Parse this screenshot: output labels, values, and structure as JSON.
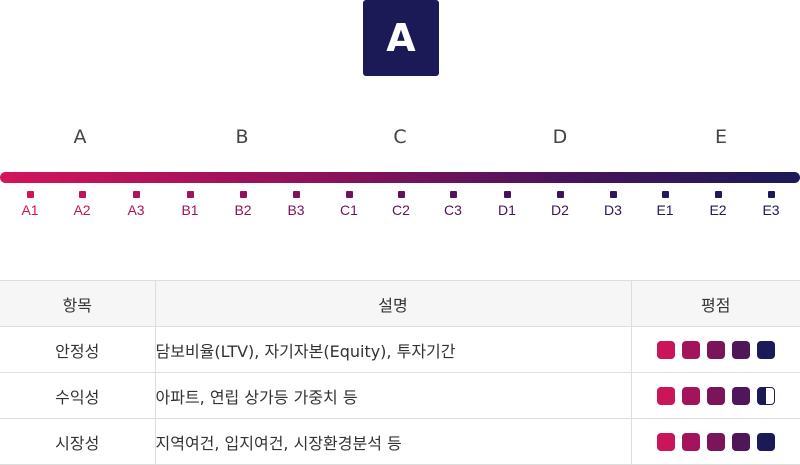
{
  "grade": {
    "badge": "A"
  },
  "scale": {
    "groups": [
      "A",
      "B",
      "C",
      "D",
      "E"
    ],
    "ticks": [
      "A1",
      "A2",
      "A3",
      "B1",
      "B2",
      "B3",
      "C1",
      "C2",
      "C3",
      "D1",
      "D2",
      "D3",
      "E1",
      "E2",
      "E3"
    ]
  },
  "colors": {
    "badge": "#1b1a57",
    "tick_colors": [
      "#cf145a",
      "#c1145a",
      "#b1135a",
      "#a1135a",
      "#91125a",
      "#81125a",
      "#71125a",
      "#61135a",
      "#53135a",
      "#45145a",
      "#3a155a",
      "#2f165a",
      "#261759",
      "#211858",
      "#1b1a57"
    ],
    "rating_squares": [
      "#cb1559",
      "#a2155a",
      "#7a1559",
      "#4f1759",
      "#1b1a57"
    ]
  },
  "table": {
    "headers": {
      "item": "항목",
      "description": "설명",
      "rating": "평점"
    },
    "rows": [
      {
        "item": "안정성",
        "description": "담보비율(LTV), 자기자본(Equity), 투자기간",
        "rating": 5
      },
      {
        "item": "수익성",
        "description": "아파트, 연립 상가등 가중치 등",
        "rating": 4.5
      },
      {
        "item": "시장성",
        "description": "지역여건, 입지여건, 시장환경분석 등",
        "rating": 5
      }
    ]
  }
}
